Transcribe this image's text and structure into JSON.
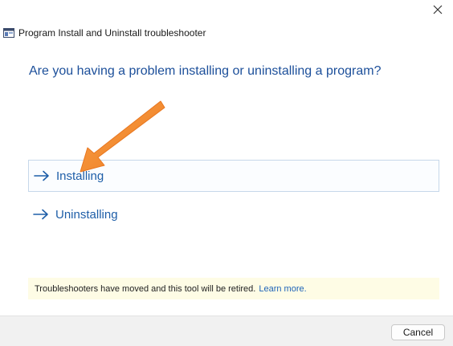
{
  "window": {
    "title": "Program Install and Uninstall troubleshooter",
    "app_icon": "troubleshooter-icon",
    "close_icon": "close-icon"
  },
  "main": {
    "question": "Are you having a problem installing or uninstalling a program?",
    "options": [
      {
        "label": "Installing",
        "icon": "arrow-right-icon",
        "selected": true
      },
      {
        "label": "Uninstalling",
        "icon": "arrow-right-icon",
        "selected": false
      }
    ]
  },
  "notice": {
    "text": "Troubleshooters have moved and this tool will be retired.",
    "link_text": "Learn more."
  },
  "footer": {
    "cancel_label": "Cancel"
  },
  "colors": {
    "heading": "#1c4f9a",
    "option_text": "#1e5ea8",
    "link": "#1e63b8",
    "notice_bg": "#fefce5",
    "annotation_arrow": "#f58a2c"
  }
}
